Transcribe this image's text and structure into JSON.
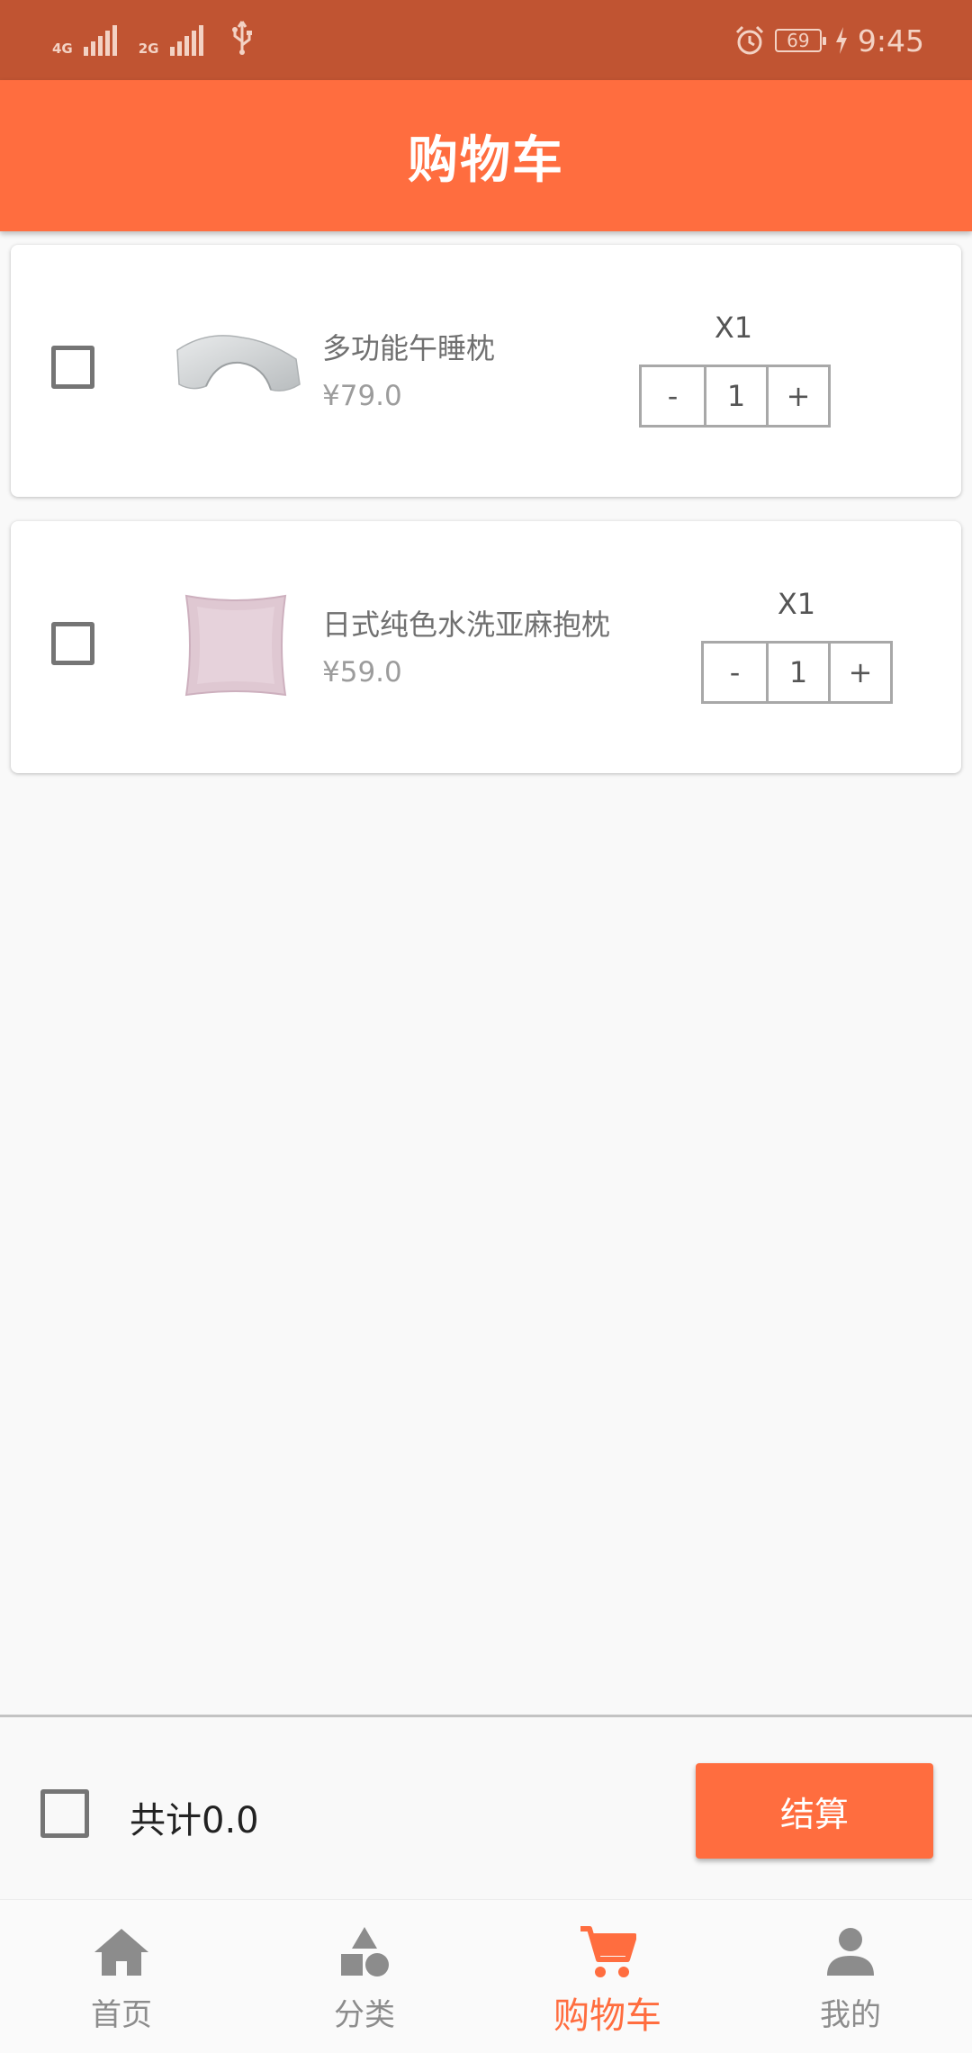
{
  "status_bar": {
    "network_1": "4G",
    "network_2": "2G",
    "battery_level": "69",
    "time": "9:45",
    "icons": [
      "signal-icon",
      "usb-icon",
      "alarm-icon",
      "battery-icon",
      "charging-bolt-icon"
    ]
  },
  "header": {
    "title": "购物车"
  },
  "cart": {
    "items": [
      {
        "name": "多功能午睡枕",
        "price": "¥79.0",
        "quantity_label": "X1",
        "quantity": "1",
        "minus": "-",
        "plus": "+",
        "selected": false,
        "thumbnail": "gray-nap-pillow-image"
      },
      {
        "name": "日式纯色水洗亚麻抱枕",
        "price": "¥59.0",
        "quantity_label": "X1",
        "quantity": "1",
        "minus": "-",
        "plus": "+",
        "selected": false,
        "thumbnail": "pink-linen-cushion-image"
      }
    ]
  },
  "checkout": {
    "total_text": "共计0.0",
    "button_label": "结算",
    "select_all": false
  },
  "nav": {
    "items": [
      {
        "label": "首页",
        "icon": "home-icon",
        "active": false
      },
      {
        "label": "分类",
        "icon": "category-icon",
        "active": false
      },
      {
        "label": "购物车",
        "icon": "cart-icon",
        "active": true
      },
      {
        "label": "我的",
        "icon": "person-icon",
        "active": false
      }
    ]
  },
  "colors": {
    "status_bar": "#c05432",
    "accent": "#ff6d3f",
    "background": "#f9f9f9",
    "inactive_nav": "#8c8c8c"
  }
}
